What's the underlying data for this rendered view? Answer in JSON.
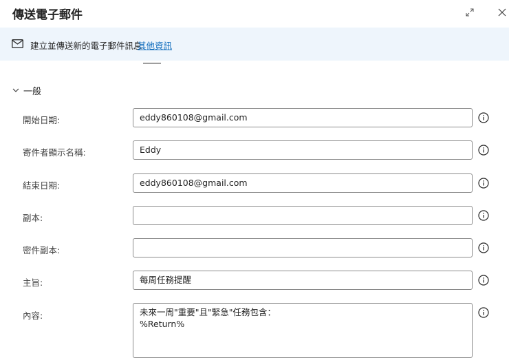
{
  "dialog": {
    "title": "傳送電子郵件"
  },
  "banner": {
    "text": "建立並傳送新的電子郵件訊息",
    "link": "其他資訊"
  },
  "section": {
    "label": "一般"
  },
  "fields": [
    {
      "label": "開始日期:",
      "value": "eddy860108@gmail.com"
    },
    {
      "label": "寄件者顯示名稱:",
      "value": "Eddy"
    },
    {
      "label": "結束日期:",
      "value": "eddy860108@gmail.com"
    },
    {
      "label": "副本:",
      "value": ""
    },
    {
      "label": "密件副本:",
      "value": ""
    },
    {
      "label": "主旨:",
      "value": "每周任務提醒"
    },
    {
      "label": "內容:",
      "value": "未來一周\"重要\"且\"緊急\"任務包含：\n%Return%"
    }
  ],
  "icons": {
    "expand": "expand-icon",
    "close": "close-icon",
    "mail": "mail-icon",
    "chevron": "chevron-down-icon",
    "info": "info-icon"
  },
  "colors": {
    "banner_bg": "#eef5fc",
    "link": "#0f6cbd",
    "border": "#8a8a8a"
  }
}
